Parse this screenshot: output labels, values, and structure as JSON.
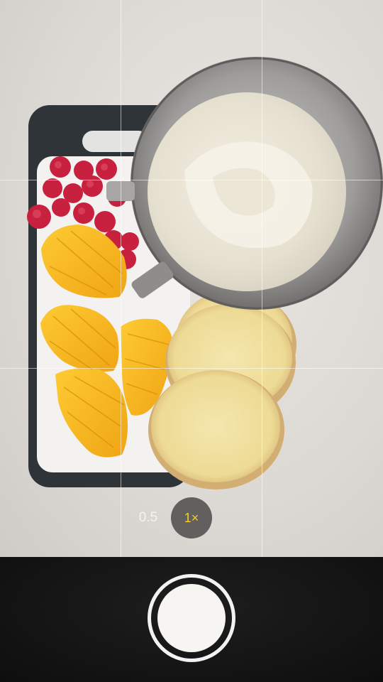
{
  "camera": {
    "zoom_options": [
      {
        "label": "0.5",
        "selected": false
      },
      {
        "label": "1×",
        "selected": true
      }
    ],
    "selected_zoom_color": "#f5cf23"
  },
  "viewfinder": {
    "grid_overlay": true
  },
  "shutter": {
    "icon": "shutter-button"
  }
}
